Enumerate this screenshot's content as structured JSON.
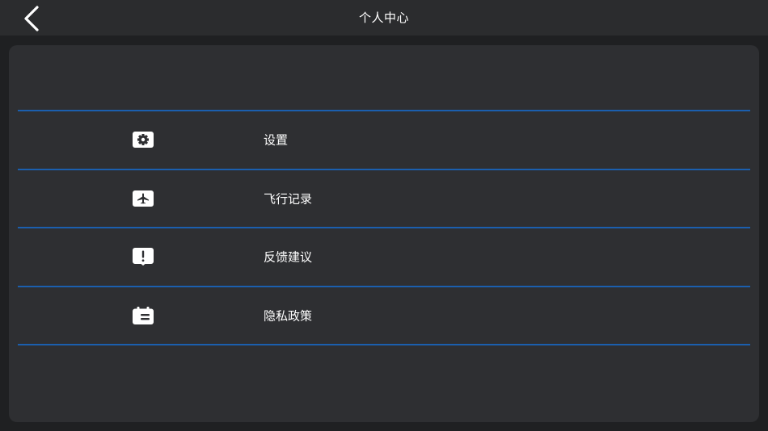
{
  "header": {
    "title": "个人中心",
    "back_icon": "chevron-left-icon"
  },
  "colors": {
    "background": "#1f2022",
    "topbar": "#2b2c2e",
    "panel": "#2e2f32",
    "divider": "#1b5fae",
    "text": "#ffffff"
  },
  "menu": {
    "items": [
      {
        "label": "设置",
        "icon": "gear-icon"
      },
      {
        "label": "飞行记录",
        "icon": "airplane-icon"
      },
      {
        "label": "反馈建议",
        "icon": "feedback-icon"
      },
      {
        "label": "隐私政策",
        "icon": "privacy-icon"
      }
    ]
  }
}
